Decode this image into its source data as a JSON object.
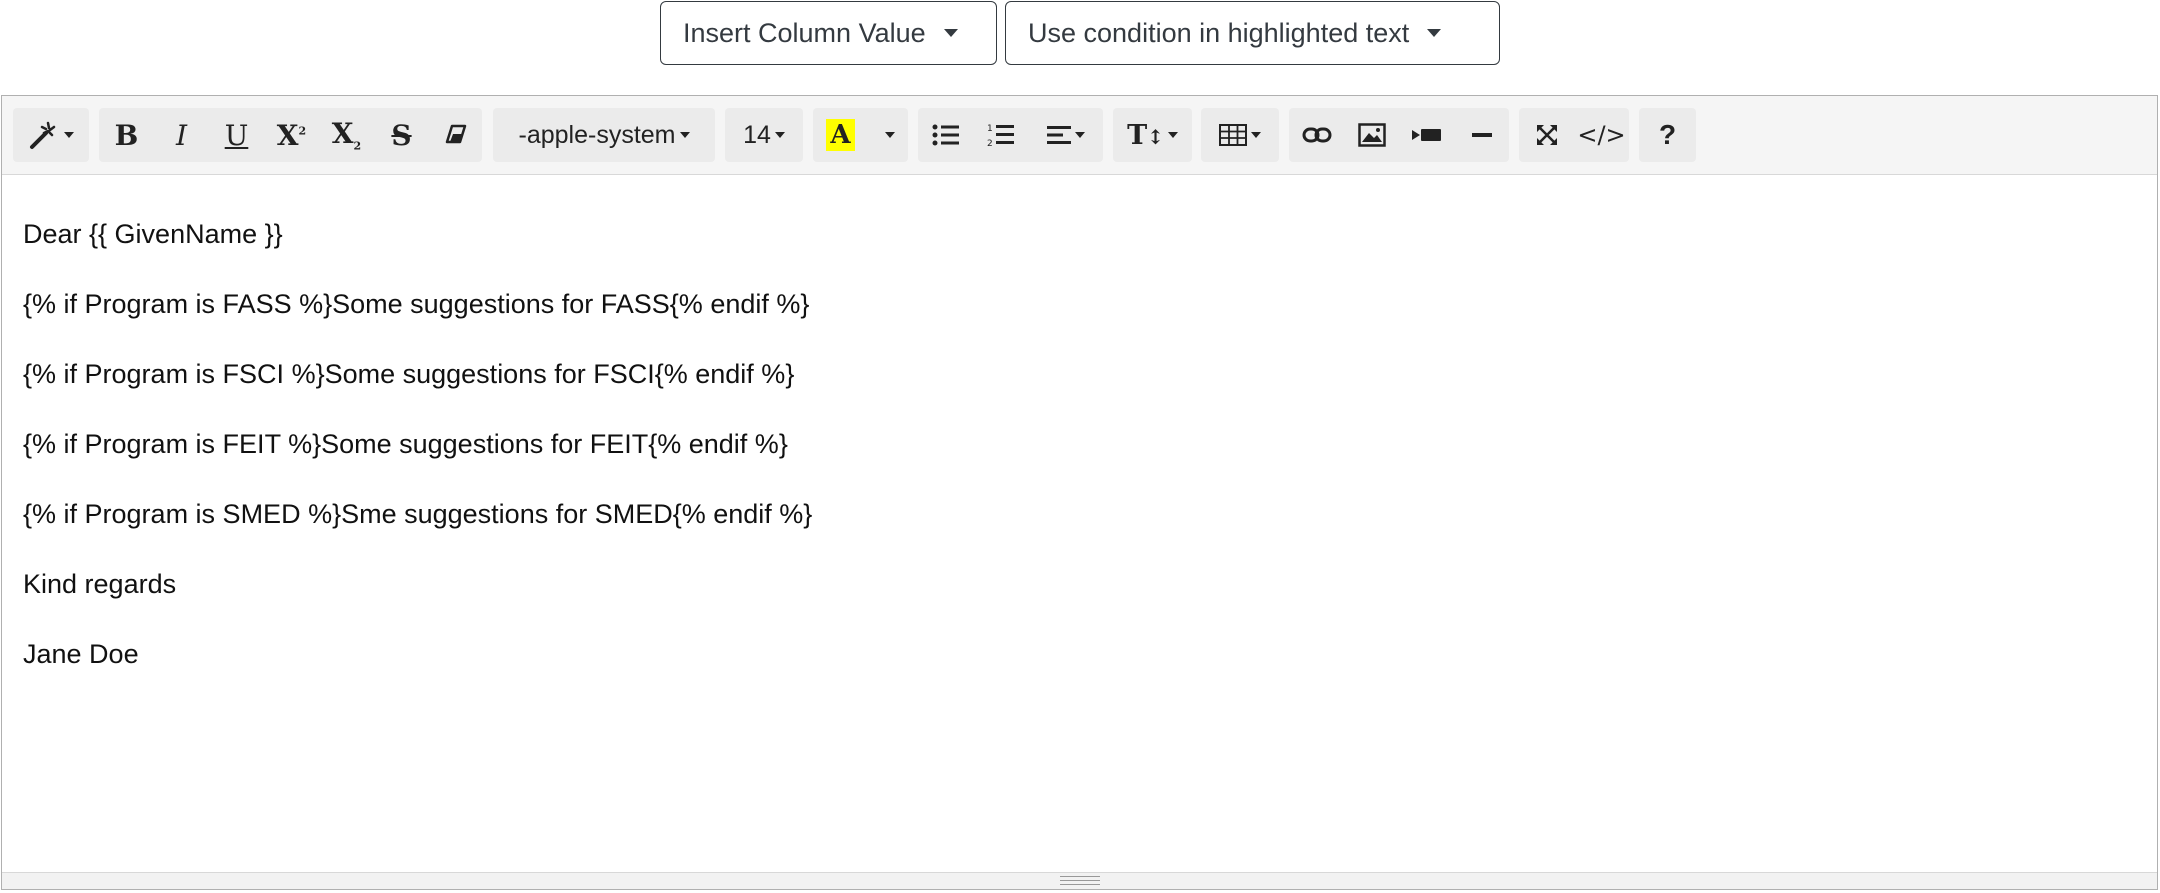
{
  "top_buttons": {
    "insert_column": "Insert Column Value",
    "use_condition": "Use condition in highlighted text"
  },
  "toolbar": {
    "font_family": "-apple-system",
    "font_size": "14",
    "highlight_letter": "A",
    "highlight_color": "#ffff00",
    "bold": "B",
    "italic": "I",
    "underline": "U",
    "superscript": "X",
    "superscript_mark": "2",
    "subscript": "X",
    "subscript_mark": "2",
    "strikethrough": "S",
    "code_view": "</>",
    "help": "?",
    "font_size_tool": "T"
  },
  "content": {
    "lines": [
      "Dear {{ GivenName }}",
      "{% if Program is FASS %}Some suggestions for FASS{% endif %}",
      "{% if Program is FSCI %}Some suggestions for FSCI{% endif %}",
      "{% if Program is FEIT %}Some suggestions for FEIT{% endif %}",
      "{% if Program is SMED %}Sme suggestions for SMED{% endif %}",
      "Kind regards",
      "Jane Doe"
    ]
  }
}
